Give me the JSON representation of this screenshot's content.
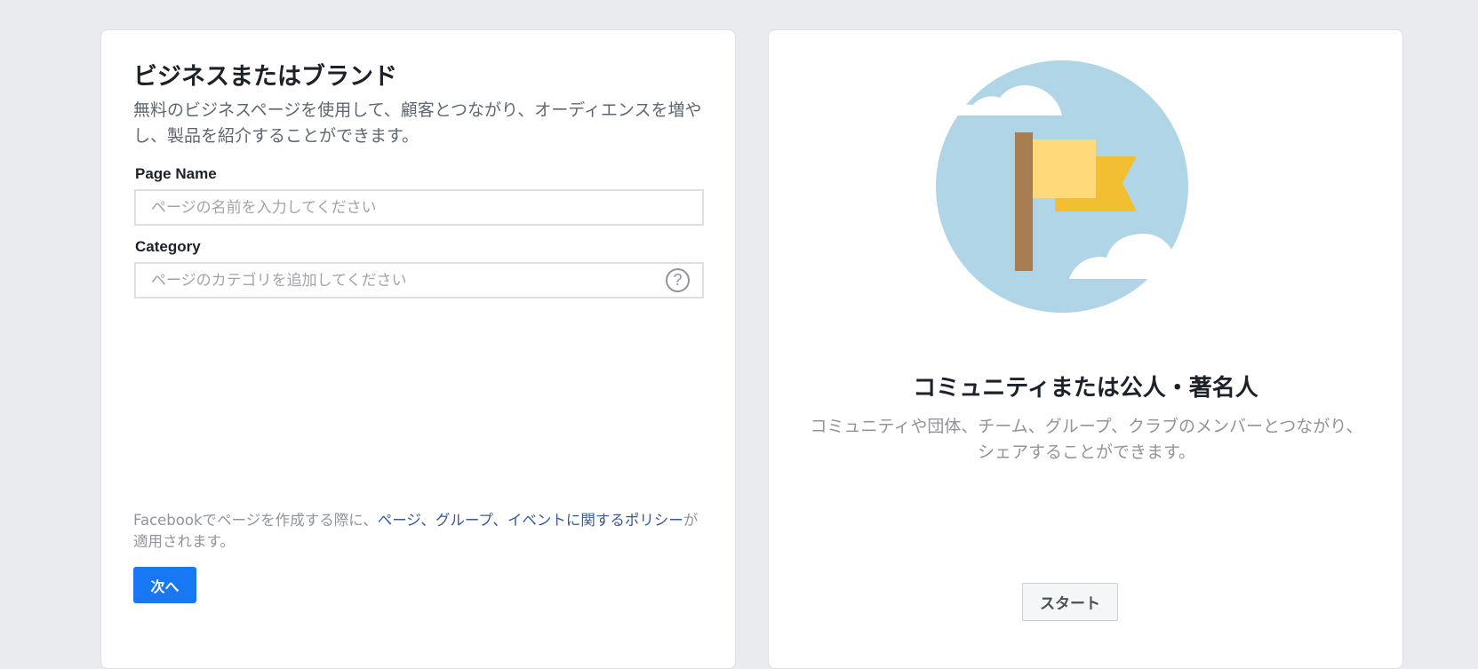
{
  "business": {
    "title": "ビジネスまたはブランド",
    "description": "無料のビジネスページを使用して、顧客とつながり、オーディエンスを増やし、製品を紹介することができます。",
    "page_name_label": "Page Name",
    "page_name_placeholder": "ページの名前を入力してください",
    "page_name_value": "",
    "category_label": "Category",
    "category_placeholder": "ページのカテゴリを追加してください",
    "category_value": "",
    "help_icon": "question-circle-icon",
    "help_glyph": "?",
    "policy": {
      "prefix": "Facebookでページを作成する際に、",
      "link": "ページ、グループ、イベントに関するポリシー",
      "suffix": "が適用されます。"
    },
    "next_label": "次へ"
  },
  "community": {
    "illustration_icon": "flag-with-clouds-icon",
    "title": "コミュニティまたは公人・著名人",
    "description": "コミュニティや団体、チーム、グループ、クラブのメンバーとつながり、シェアすることができます。",
    "start_label": "スタート"
  },
  "colors": {
    "background": "#e9ebee",
    "primary_button": "#1877f2",
    "link": "#385898",
    "illustration_circle": "#b0d5e6",
    "flag_light": "#ffd97a",
    "flag_dark": "#f2bf33",
    "pole": "#a67c52"
  }
}
